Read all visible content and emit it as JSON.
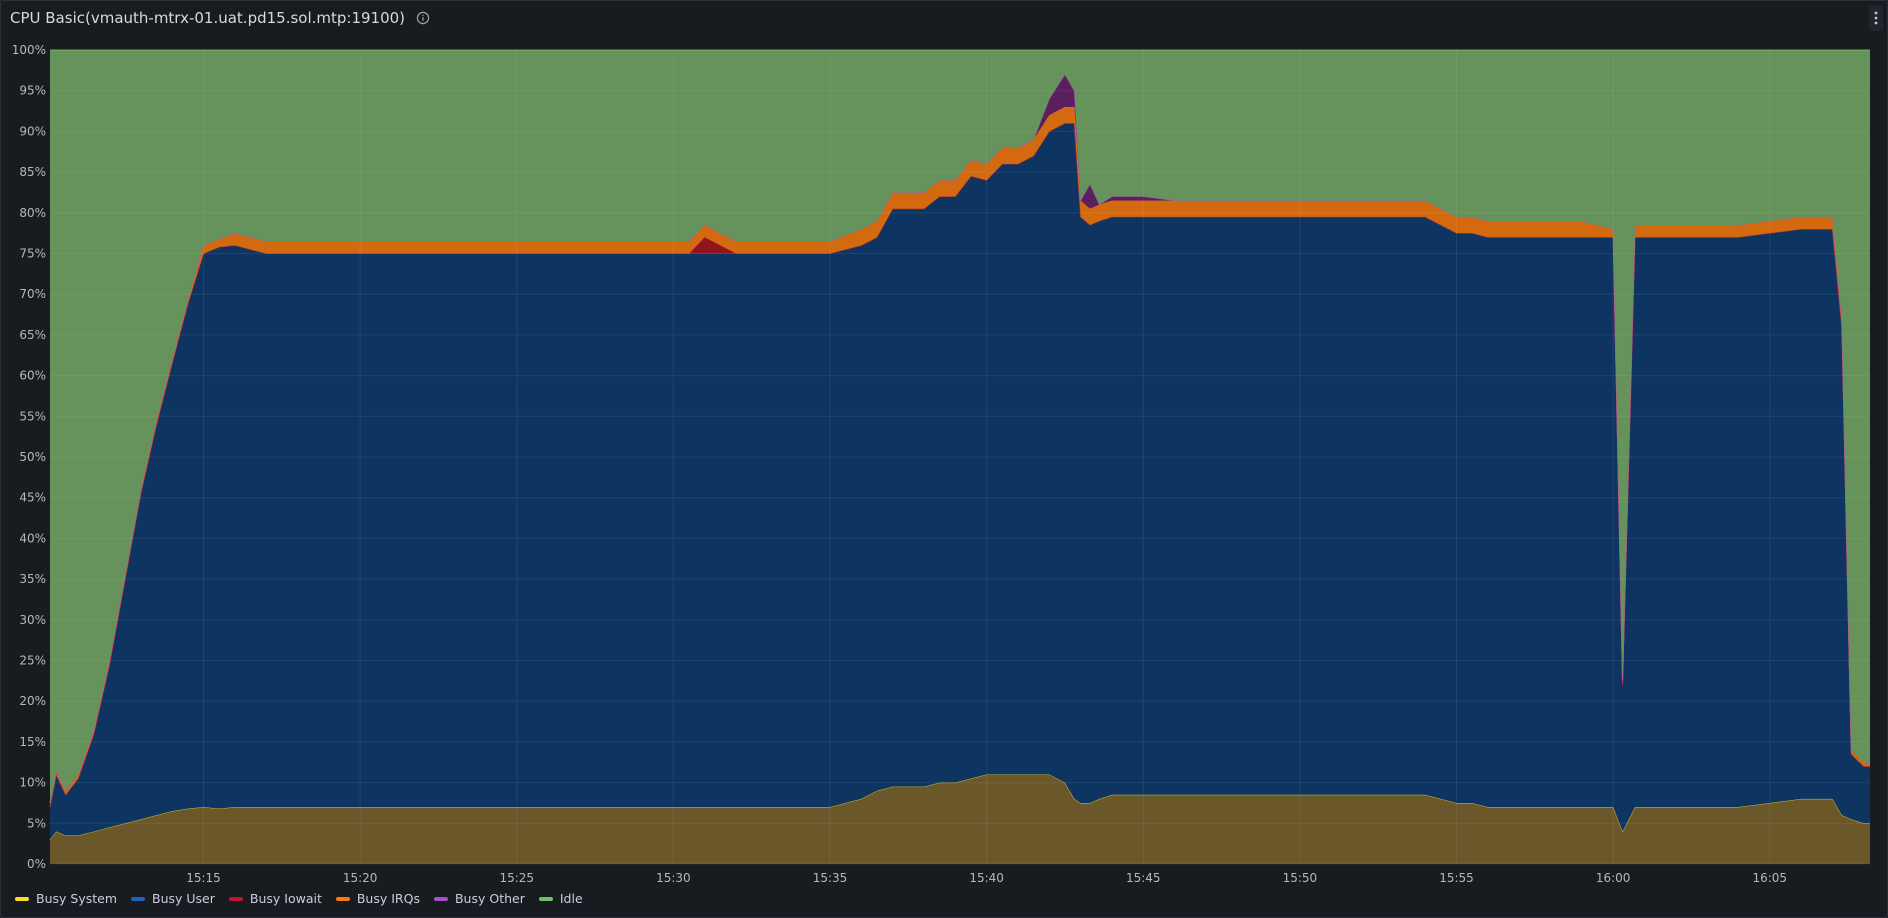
{
  "panel": {
    "title": "CPU Basic(vmauth-mtrx-01.uat.pd15.sol.mtp:19100)",
    "info_icon": "info-circle-icon",
    "menu_icon": "kebab-menu-icon"
  },
  "chart_data": {
    "type": "area",
    "title": "CPU Basic(vmauth-mtrx-01.uat.pd15.sol.mtp:19100)",
    "stacked": true,
    "xlabel": "",
    "ylabel": "",
    "ylim": [
      0,
      100
    ],
    "xlim": [
      "15:10.1",
      "16:08.2"
    ],
    "grid": true,
    "legend": "bottom-left",
    "y_ticks": [
      "0%",
      "5%",
      "10%",
      "15%",
      "20%",
      "25%",
      "30%",
      "35%",
      "40%",
      "45%",
      "50%",
      "55%",
      "60%",
      "65%",
      "70%",
      "75%",
      "80%",
      "85%",
      "90%",
      "95%",
      "100%"
    ],
    "x_ticks": [
      "15:15",
      "15:20",
      "15:25",
      "15:30",
      "15:35",
      "15:40",
      "15:45",
      "15:50",
      "15:55",
      "16:00",
      "16:05"
    ],
    "x": [
      "15:10.1",
      "15:10.3",
      "15:10.6",
      "15:11",
      "15:11.5",
      "15:12",
      "15:12.5",
      "15:13",
      "15:13.5",
      "15:14",
      "15:14.5",
      "15:15",
      "15:15.5",
      "15:16",
      "15:17",
      "15:18",
      "15:19",
      "15:20",
      "15:21",
      "15:22",
      "15:23",
      "15:24",
      "15:25",
      "15:26",
      "15:27",
      "15:28",
      "15:29",
      "15:30",
      "15:30.5",
      "15:31",
      "15:32",
      "15:33",
      "15:34",
      "15:35",
      "15:36",
      "15:36.5",
      "15:37",
      "15:38",
      "15:38.5",
      "15:39",
      "15:39.5",
      "15:40",
      "15:40.5",
      "15:41",
      "15:41.5",
      "15:42",
      "15:42.5",
      "15:42.8",
      "15:43",
      "15:43.3",
      "15:43.6",
      "15:44",
      "15:45",
      "15:46",
      "15:46.5",
      "15:47",
      "15:48",
      "15:49",
      "15:50",
      "15:51",
      "15:52",
      "15:53",
      "15:54",
      "15:55",
      "15:55.5",
      "15:56",
      "15:57",
      "15:58",
      "15:59",
      "16:00",
      "16:00.3",
      "16:00.7",
      "16:01",
      "16:01.5",
      "16:02",
      "16:03",
      "16:04",
      "16:05",
      "16:06",
      "16:07",
      "16:07.3",
      "16:07.6",
      "16:08",
      "16:08.2"
    ],
    "series": [
      {
        "name": "Busy System",
        "color": "#fade2a",
        "fill": "#6b582a",
        "values": [
          3,
          4,
          3.5,
          3.5,
          4,
          4.5,
          5,
          5.5,
          6,
          6.5,
          6.8,
          7,
          6.8,
          7,
          7,
          7,
          7,
          7,
          7,
          7,
          7,
          7,
          7,
          7,
          7,
          7,
          7,
          7,
          7,
          7,
          7,
          7,
          7,
          7,
          8,
          9,
          9.5,
          9.5,
          10,
          10,
          10.5,
          11,
          11,
          11,
          11,
          11,
          10,
          8,
          7.5,
          7.5,
          8,
          8.5,
          8.5,
          8.5,
          8.5,
          8.5,
          8.5,
          8.5,
          8.5,
          8.5,
          8.5,
          8.5,
          8.5,
          7.5,
          7.5,
          7,
          7,
          7,
          7,
          7,
          4,
          7,
          7,
          7,
          7,
          7,
          7,
          7.5,
          8,
          8,
          6,
          5.5,
          5,
          5
        ]
      },
      {
        "name": "Busy User",
        "color": "#1f60c4",
        "fill": "#0e3561",
        "values": [
          4,
          7,
          5,
          7,
          12,
          20,
          30,
          40,
          48,
          55,
          62,
          68,
          69,
          69,
          68,
          68,
          68,
          68,
          68,
          68,
          68,
          68,
          68,
          68,
          68,
          68,
          68,
          68,
          68,
          68,
          68,
          68,
          68,
          68,
          68,
          68,
          71,
          71,
          72,
          72,
          74,
          73,
          75,
          75,
          76,
          79,
          81,
          83,
          72,
          71,
          71,
          71,
          71,
          71,
          71,
          71,
          71,
          71,
          71,
          71,
          71,
          71,
          71,
          70,
          70,
          70,
          70,
          70,
          70,
          70,
          18,
          70,
          70,
          70,
          70,
          70,
          70,
          70,
          70,
          70,
          60,
          8,
          7,
          7
        ]
      },
      {
        "name": "Busy Iowait",
        "color": "#c4162a",
        "fill": "#8f1420",
        "values": [
          0,
          0,
          0,
          0,
          0,
          0,
          0,
          0,
          0,
          0,
          0,
          0,
          0,
          0,
          0,
          0,
          0,
          0,
          0,
          0,
          0,
          0,
          0,
          0,
          0,
          0,
          0,
          0,
          0,
          2,
          0,
          0,
          0,
          0,
          0,
          0,
          0,
          0,
          0,
          0,
          0,
          0,
          0,
          0,
          0,
          0,
          0,
          0,
          0,
          0,
          0,
          0,
          0,
          0,
          0,
          0,
          0,
          0,
          0,
          0,
          0,
          0,
          0,
          0,
          0,
          0,
          0,
          0,
          0,
          0,
          0,
          0,
          0,
          0,
          0,
          0,
          0,
          0,
          0,
          0,
          0,
          0,
          0,
          0
        ]
      },
      {
        "name": "Busy IRQs",
        "color": "#ff780a",
        "fill": "#d46a10",
        "values": [
          0.5,
          0.5,
          0.5,
          0.5,
          0.5,
          0.5,
          0.5,
          0.5,
          0.5,
          0.5,
          0.5,
          1,
          1,
          1.5,
          1.5,
          1.5,
          1.5,
          1.5,
          1.5,
          1.5,
          1.5,
          1.5,
          1.5,
          1.5,
          1.5,
          1.5,
          1.5,
          1.5,
          1.5,
          1.5,
          1.5,
          1.5,
          1.5,
          1.5,
          2,
          2,
          2,
          2,
          2,
          2,
          2,
          2,
          2,
          2,
          2,
          2,
          2,
          2,
          2,
          2,
          2,
          2,
          2,
          2,
          2,
          2,
          2,
          2,
          2,
          2,
          2,
          2,
          2,
          2,
          2,
          2,
          2,
          2,
          2,
          1,
          0.5,
          1.5,
          1.5,
          1.5,
          1.5,
          1.5,
          1.5,
          1.5,
          1.5,
          1.5,
          1,
          0.5,
          0.5,
          0.5
        ]
      },
      {
        "name": "Busy Other",
        "color": "#a352cc",
        "fill": "#5c1f5e",
        "values": [
          0,
          0,
          0,
          0,
          0,
          0,
          0,
          0,
          0,
          0,
          0,
          0,
          0,
          0,
          0,
          0,
          0,
          0,
          0,
          0,
          0,
          0,
          0,
          0,
          0,
          0,
          0,
          0,
          0,
          0,
          0,
          0,
          0,
          0,
          0,
          0,
          0,
          0,
          0,
          0,
          0,
          0,
          0,
          0,
          0,
          2,
          4,
          2,
          0,
          3,
          0,
          0.5,
          0.5,
          0,
          0,
          0,
          0,
          0,
          0,
          0,
          0,
          0,
          0,
          0,
          0,
          0,
          0,
          0,
          0,
          0,
          0,
          0,
          0,
          0,
          0,
          0,
          0,
          0,
          0,
          0,
          0,
          0,
          0,
          0
        ]
      },
      {
        "name": "Idle",
        "color": "#73bf69",
        "fill": "#66925b",
        "values": [
          92.5,
          88.5,
          91,
          89,
          83.5,
          75,
          64.5,
          54,
          45.5,
          38,
          30.7,
          24,
          23.2,
          22.5,
          23.5,
          23.5,
          23.5,
          23.5,
          23.5,
          23.5,
          23.5,
          23.5,
          23.5,
          23.5,
          23.5,
          23.5,
          23.5,
          23.5,
          23.5,
          21.5,
          23.5,
          23.5,
          23.5,
          23.5,
          22,
          21,
          17.5,
          17.5,
          16,
          16,
          13.5,
          14,
          12,
          12,
          11,
          6,
          3,
          5,
          18.5,
          16.5,
          19,
          18,
          18,
          18.5,
          18.5,
          18.5,
          18.5,
          18.5,
          18.5,
          18.5,
          18.5,
          18.5,
          18.5,
          20.5,
          20.5,
          21,
          21,
          21,
          21,
          22,
          77.5,
          21.5,
          21.5,
          21.5,
          21.5,
          21.5,
          21.5,
          21,
          20.5,
          20.5,
          33,
          86,
          87.5,
          87.5
        ]
      }
    ]
  }
}
